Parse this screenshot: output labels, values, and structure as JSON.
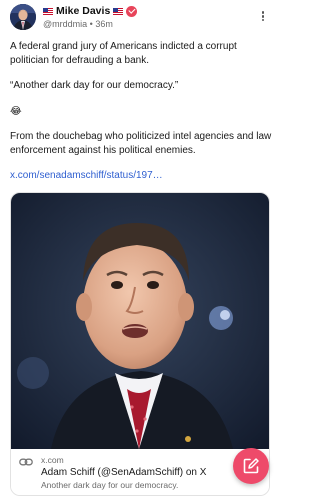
{
  "author": {
    "flag_left": "🇺🇸",
    "name": "Mike Davis",
    "flag_right": "🇺🇸",
    "handle": "@mrddmia",
    "separator": "•",
    "time": "36m"
  },
  "post": {
    "paragraph_1": "A federal grand jury of Americans indicted a corrupt politician for defrauding a bank.",
    "paragraph_2": "“Another dark day for our democracy.”",
    "emoji": "😂",
    "paragraph_3": "From the douchebag who politicized intel agencies and law enforcement against his political enemies.",
    "link": "x.com/senadamschiff/status/197…"
  },
  "link_card": {
    "domain": "x.com",
    "title": "Adam Schiff (@SenAdamSchiff) on X",
    "description": "Another dark day for our democracy."
  },
  "icons": {
    "verified": "verified-badge-icon",
    "more": "more-vertical-icon",
    "link": "link-icon",
    "compose": "compose-icon"
  },
  "colors": {
    "accent": "#ee4a6a",
    "link": "#2f5fd0",
    "verified": "#e8445a"
  }
}
